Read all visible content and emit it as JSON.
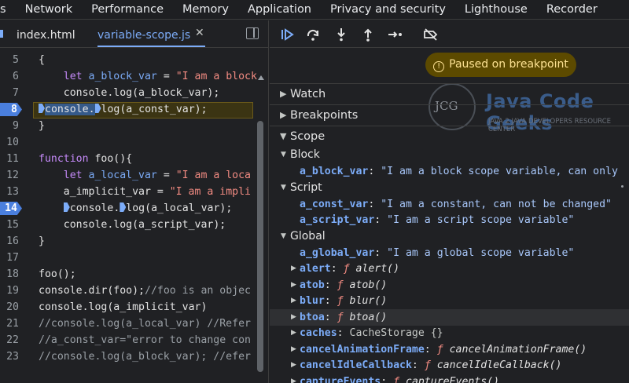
{
  "top_tabs": [
    "s",
    "Network",
    "Performance",
    "Memory",
    "Application",
    "Privacy and security",
    "Lighthouse",
    "Recorder"
  ],
  "file_tabs": [
    {
      "label": "index.html",
      "active": false
    },
    {
      "label": "variable-scope.js",
      "active": true
    }
  ],
  "close_glyph": "✕",
  "code_lines": [
    {
      "ln": "5",
      "parts": [
        [
          "p",
          "{"
        ]
      ]
    },
    {
      "ln": "6",
      "parts": [
        [
          "p",
          "    "
        ],
        [
          "kw",
          "let "
        ],
        [
          "vr",
          "a_block_var"
        ],
        [
          "p",
          " = "
        ],
        [
          "st",
          "\"I am a block"
        ]
      ]
    },
    {
      "ln": "7",
      "parts": [
        [
          "p",
          "    console."
        ],
        [
          "fn",
          "log"
        ],
        [
          "p",
          "(a_block_var);"
        ]
      ]
    },
    {
      "ln": "8",
      "bp": true,
      "highlight": true,
      "parts": [
        [
          "m",
          ""
        ],
        [
          "sel",
          "console."
        ],
        [
          "m",
          ""
        ],
        [
          "fn",
          "log"
        ],
        [
          "p",
          "(a_const_var);"
        ]
      ]
    },
    {
      "ln": "9",
      "parts": [
        [
          "p",
          "}"
        ]
      ]
    },
    {
      "ln": "10",
      "parts": []
    },
    {
      "ln": "11",
      "parts": [
        [
          "kw",
          "function "
        ],
        [
          "fn",
          "foo"
        ],
        [
          "p",
          "(){"
        ]
      ]
    },
    {
      "ln": "12",
      "parts": [
        [
          "p",
          "    "
        ],
        [
          "kw",
          "let "
        ],
        [
          "vr",
          "a_local_var"
        ],
        [
          "p",
          " = "
        ],
        [
          "st",
          "\"I am a loca"
        ]
      ]
    },
    {
      "ln": "13",
      "parts": [
        [
          "p",
          "    a_implicit_var = "
        ],
        [
          "st",
          "\"I am a impli"
        ]
      ]
    },
    {
      "ln": "14",
      "bp": true,
      "parts": [
        [
          "p",
          "    "
        ],
        [
          "m",
          ""
        ],
        [
          "p",
          "console."
        ],
        [
          "m",
          ""
        ],
        [
          "fn",
          "log"
        ],
        [
          "p",
          "(a_local_var);"
        ]
      ]
    },
    {
      "ln": "15",
      "parts": [
        [
          "p",
          "    console."
        ],
        [
          "fn",
          "log"
        ],
        [
          "p",
          "(a_script_var);"
        ]
      ]
    },
    {
      "ln": "16",
      "parts": [
        [
          "p",
          "}"
        ]
      ]
    },
    {
      "ln": "17",
      "parts": []
    },
    {
      "ln": "18",
      "parts": [
        [
          "p",
          "foo();"
        ]
      ]
    },
    {
      "ln": "19",
      "parts": [
        [
          "p",
          "console."
        ],
        [
          "fn",
          "dir"
        ],
        [
          "p",
          "(foo);"
        ],
        [
          "cm",
          "//foo is an objec"
        ]
      ]
    },
    {
      "ln": "20",
      "parts": [
        [
          "p",
          "console."
        ],
        [
          "fn",
          "log"
        ],
        [
          "p",
          "(a_implicit_var)"
        ]
      ]
    },
    {
      "ln": "21",
      "parts": [
        [
          "cm",
          "//console.log(a_local_var) //Refer"
        ]
      ]
    },
    {
      "ln": "22",
      "parts": [
        [
          "cm",
          "//a_const_var=\"error to change con"
        ]
      ]
    },
    {
      "ln": "23",
      "parts": [
        [
          "cm",
          "//console.log(a_block_var); //efer"
        ]
      ]
    }
  ],
  "paused_message": "Paused on breakpoint",
  "paused_icon": "!",
  "sections": [
    "Watch",
    "Breakpoints",
    "Scope"
  ],
  "logo": {
    "mark": "JCG",
    "brand": "Java Code Geeks",
    "tagline": "JAVA 2 JAVA DEVELOPERS RESOURCE CENTER"
  },
  "scope": {
    "block_label": "Block",
    "block_items": [
      {
        "name": "a_block_var",
        "value": "\"I am a block scope variable, can only"
      }
    ],
    "script_label": "Script",
    "script_items": [
      {
        "name": "a_const_var",
        "value": "\"I am a constant, can not be changed\""
      },
      {
        "name": "a_script_var",
        "value": "\"I am a script scope variable\""
      }
    ],
    "global_label": "Global",
    "global_items": [
      {
        "name": "a_global_var",
        "value": "\"I am a global scope variable\"",
        "kind": "str"
      },
      {
        "name": "alert",
        "value": "alert()",
        "kind": "fn",
        "expand": true
      },
      {
        "name": "atob",
        "value": "atob()",
        "kind": "fn",
        "expand": true
      },
      {
        "name": "blur",
        "value": "blur()",
        "kind": "fn",
        "expand": true
      },
      {
        "name": "btoa",
        "value": "btoa()",
        "kind": "fn",
        "expand": true,
        "hover": true
      },
      {
        "name": "caches",
        "value": "CacheStorage {}",
        "kind": "obj",
        "expand": true
      },
      {
        "name": "cancelAnimationFrame",
        "value": "cancelAnimationFrame()",
        "kind": "fn",
        "expand": true
      },
      {
        "name": "cancelIdleCallback",
        "value": "cancelIdleCallback()",
        "kind": "fn",
        "expand": true
      },
      {
        "name": "captureEvents",
        "value": "captureEvents()",
        "kind": "fn",
        "expand": true
      }
    ]
  }
}
